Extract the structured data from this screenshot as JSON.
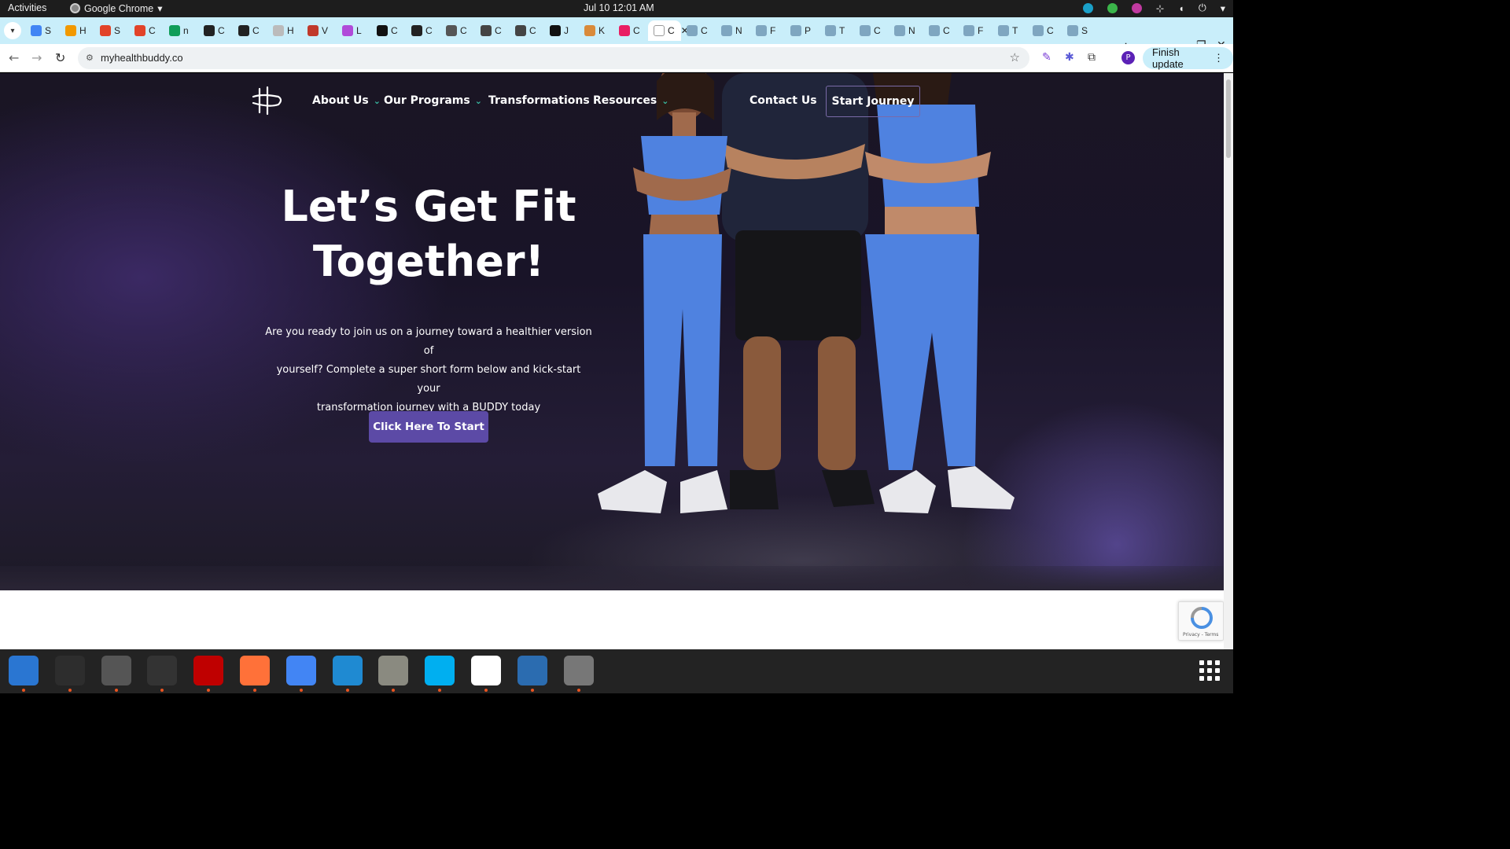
{
  "system": {
    "activities": "Activities",
    "app_name": "Google Chrome",
    "clock": "Jul 10  12:01 AM"
  },
  "tabs": [
    {
      "letter": "S",
      "color": "#4285f4"
    },
    {
      "letter": "H",
      "color": "#f29900"
    },
    {
      "letter": "S",
      "color": "#e24329"
    },
    {
      "letter": "C",
      "color": "#e24329"
    },
    {
      "letter": "n",
      "color": "#0f9d58"
    },
    {
      "letter": "C",
      "color": "#222222"
    },
    {
      "letter": "C",
      "color": "#222222"
    },
    {
      "letter": "H",
      "color": "#bbbbbb"
    },
    {
      "letter": "V",
      "color": "#c0392b"
    },
    {
      "letter": "L",
      "color": "#b04ad9"
    },
    {
      "letter": "C",
      "color": "#111111"
    },
    {
      "letter": "C",
      "color": "#222222"
    },
    {
      "letter": "C",
      "color": "#555555"
    },
    {
      "letter": "C",
      "color": "#444444"
    },
    {
      "letter": "C",
      "color": "#444444"
    },
    {
      "letter": "J",
      "color": "#111111"
    },
    {
      "letter": "K",
      "color": "#d98a3a"
    },
    {
      "letter": "C",
      "color": "#e91e63"
    },
    {
      "letter": "C",
      "color": "#ffffff",
      "active": true
    },
    {
      "letter": "C",
      "color": "#7fa6c0"
    },
    {
      "letter": "N",
      "color": "#7fa6c0"
    },
    {
      "letter": "F",
      "color": "#7fa6c0"
    },
    {
      "letter": "P",
      "color": "#7fa6c0"
    },
    {
      "letter": "T",
      "color": "#7fa6c0"
    },
    {
      "letter": "C",
      "color": "#7fa6c0"
    },
    {
      "letter": "N",
      "color": "#7fa6c0"
    },
    {
      "letter": "C",
      "color": "#7fa6c0"
    },
    {
      "letter": "F",
      "color": "#7fa6c0"
    },
    {
      "letter": "T",
      "color": "#7fa6c0"
    },
    {
      "letter": "C",
      "color": "#7fa6c0"
    },
    {
      "letter": "S",
      "color": "#7fa6c0"
    }
  ],
  "browser": {
    "url": "myhealthbuddy.co",
    "finish_update": "Finish update",
    "profile_initial": "P"
  },
  "site": {
    "nav": {
      "about": "About Us",
      "programs": "Our Programs",
      "transformations": "Transformations",
      "resources": "Resources",
      "contact": "Contact Us",
      "start_journey": "Start Journey"
    },
    "hero": {
      "title_line1": "Let’s Get Fit",
      "title_line2": "Together!",
      "text_line1": "Are you ready to join us on a journey toward a healthier version of",
      "text_line2": "yourself? Complete a super short form below and kick-start your",
      "text_line3": "transformation journey with a BUDDY today",
      "cta": "Click Here To Start"
    },
    "recaptcha_text": "Privacy - Terms",
    "colors": {
      "accent_purple": "#5c4aa6",
      "chevron_teal": "#39c2a8",
      "outfit_blue": "#4f82e0"
    }
  },
  "dock": [
    {
      "name": "thunderbird",
      "color": "#2a76d2"
    },
    {
      "name": "terminal",
      "color": "#2d2d2d"
    },
    {
      "name": "calculator",
      "color": "#555555"
    },
    {
      "name": "system-monitor",
      "color": "#333333"
    },
    {
      "name": "filezilla",
      "color": "#bf0000"
    },
    {
      "name": "firefox",
      "color": "#ff7139"
    },
    {
      "name": "chrome",
      "color": "#4285f4"
    },
    {
      "name": "vscode",
      "color": "#1f8ad2"
    },
    {
      "name": "files",
      "color": "#8a8a80"
    },
    {
      "name": "skype",
      "color": "#00aff0"
    },
    {
      "name": "text-editor",
      "color": "#ffffff"
    },
    {
      "name": "document-viewer",
      "color": "#2b6cb0"
    },
    {
      "name": "disk-utility",
      "color": "#777777"
    }
  ]
}
